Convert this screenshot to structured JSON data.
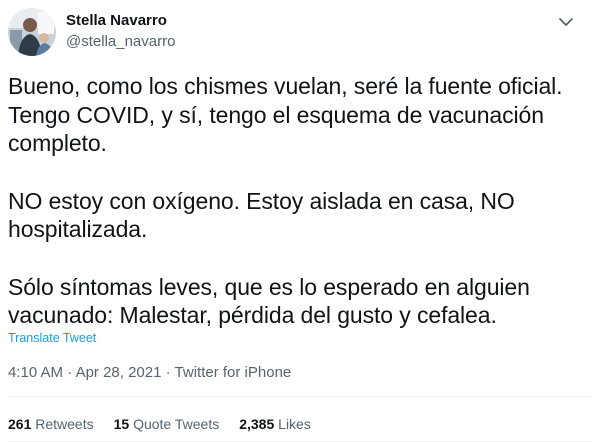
{
  "author": {
    "display_name": "Stella Navarro",
    "handle": "@stella_navarro",
    "avatar_icon": "profile-photo"
  },
  "more_icon": "chevron-down-icon",
  "tweet": {
    "paragraphs": [
      "Bueno, como los chismes vuelan, seré la fuente oficial. Tengo COVID, y sí, tengo el esquema de vacunación completo.",
      "NO estoy con oxígeno. Estoy aislada en casa, NO hospitalizada.",
      "Sólo síntomas leves, que es lo esperado en alguien vacunado: Malestar, pérdida del gusto y cefalea."
    ],
    "translate_label": "Translate Tweet"
  },
  "meta": {
    "time": "4:10 AM",
    "separator": " · ",
    "date": "Apr 28, 2021",
    "source": "Twitter for iPhone"
  },
  "stats": {
    "retweets_count": "261",
    "retweets_label": "Retweets",
    "quote_count": "15",
    "quote_label": "Quote Tweets",
    "likes_count": "2,385",
    "likes_label": "Likes"
  },
  "colors": {
    "text": "#0f1419",
    "secondary": "#536471",
    "link": "#1d9bf0",
    "divider": "#eff3f4"
  }
}
